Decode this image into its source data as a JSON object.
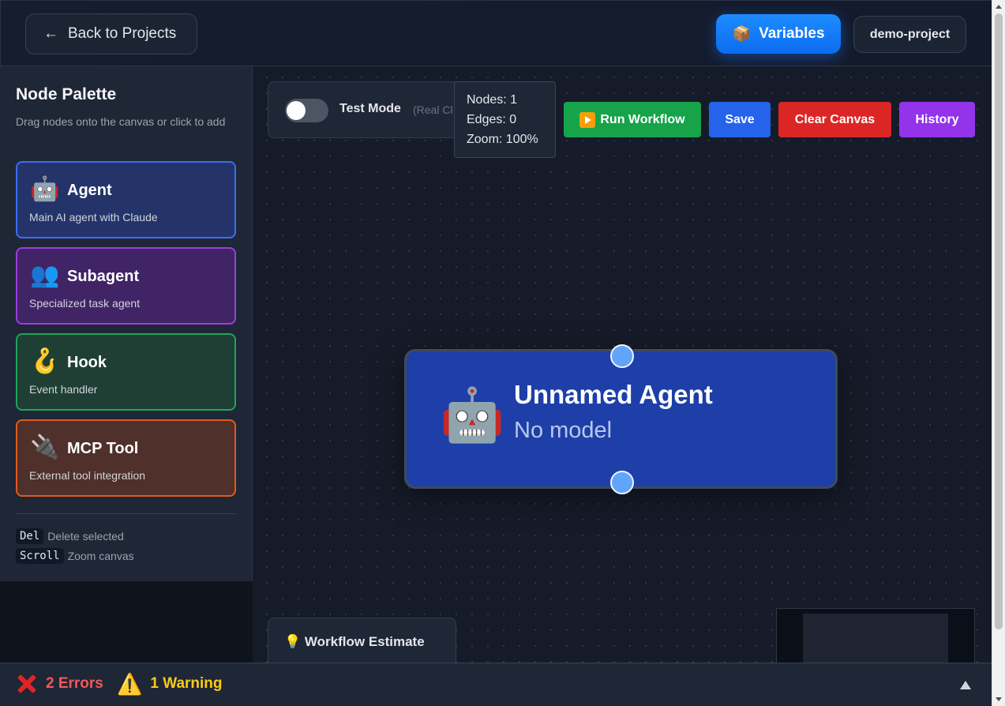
{
  "header": {
    "back_label": "Back to Projects",
    "back_arrow": "←",
    "variables_label": "Variables",
    "variables_icon": "📦",
    "project_name": "demo-project"
  },
  "sidebar": {
    "title": "Node Palette",
    "subtitle": "Drag nodes onto the canvas or click to add",
    "nodes": [
      {
        "icon": "🤖",
        "name": "Agent",
        "description": "Main AI agent with Claude",
        "color": "#3b6ef0"
      },
      {
        "icon": "👥",
        "name": "Subagent",
        "description": "Specialized task agent",
        "color": "#9b3ee0"
      },
      {
        "icon": "🪝",
        "name": "Hook",
        "description": "Event handler",
        "color": "#1fa45a"
      },
      {
        "icon": "🔌",
        "name": "MCP Tool",
        "description": "External tool integration",
        "color": "#e05a1e"
      }
    ],
    "shortcuts": [
      {
        "key": "Del",
        "action": "Delete selected"
      },
      {
        "key": "Scroll",
        "action": "Zoom canvas"
      }
    ]
  },
  "toolbar": {
    "test_mode_label": "Test Mode",
    "test_mode_note": "(Real Cl",
    "run_label": "Run Workflow",
    "save_label": "Save",
    "clear_label": "Clear Canvas",
    "history_label": "History"
  },
  "stats": {
    "nodes": "Nodes: 1",
    "edges": "Edges: 0",
    "zoom": "Zoom: 100%"
  },
  "canvas_node": {
    "icon": "🤖",
    "title": "Unnamed Agent",
    "model": "No model"
  },
  "estimate": {
    "icon": "💡",
    "title": "Workflow Estimate"
  },
  "status": {
    "errors": "2 Errors",
    "warnings": "1 Warning",
    "warning_icon": "⚠️"
  },
  "colors": {
    "accent": "#0b6cf0",
    "run": "#16a34a",
    "save": "#2563eb",
    "clear": "#dc2626",
    "history": "#9333ea",
    "error": "#ef5a5a",
    "warning": "#facc15"
  }
}
